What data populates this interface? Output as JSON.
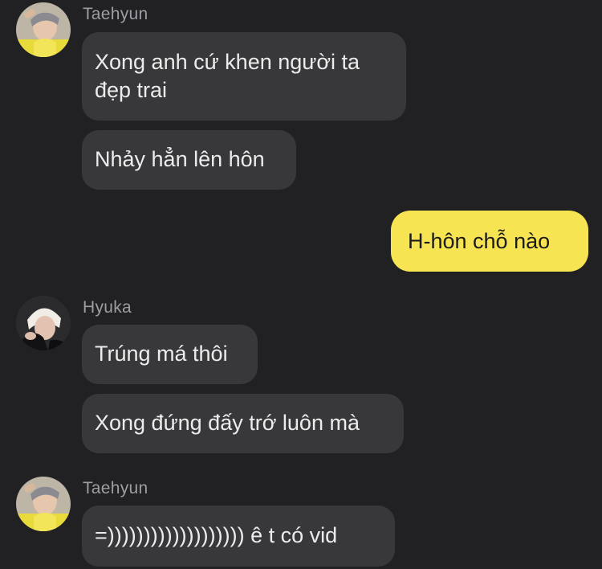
{
  "colors": {
    "background": "#212124",
    "incoming_bubble": "#38383b",
    "outgoing_bubble": "#f7e452",
    "sender_name": "#9d9da4"
  },
  "messages": [
    {
      "sender": "Taehyun",
      "avatar": "taehyun-avatar",
      "bubbles": [
        {
          "lines": [
            "Xong anh cứ khen người ta",
            "đẹp trai"
          ]
        },
        {
          "lines": [
            "Nhảy hẳn lên hôn"
          ]
        }
      ]
    },
    {
      "sender": "me",
      "bubbles": [
        {
          "lines": [
            "H-hôn chỗ nào"
          ]
        }
      ]
    },
    {
      "sender": "Hyuka",
      "avatar": "hyuka-avatar",
      "bubbles": [
        {
          "lines": [
            "Trúng má thôi"
          ]
        },
        {
          "lines": [
            "Xong đứng đấy trớ luôn mà"
          ]
        }
      ]
    },
    {
      "sender": "Taehyun",
      "avatar": "taehyun-avatar",
      "bubbles": [
        {
          "lines": [
            "=))))))))))))))))))) ê t có vid"
          ]
        }
      ]
    }
  ]
}
